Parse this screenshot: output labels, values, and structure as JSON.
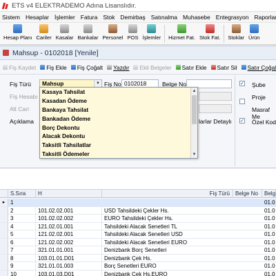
{
  "window": {
    "title": "ETS v4 ELEKTRADEMO Adına Lisanslıdır."
  },
  "menu": [
    "Sistem",
    "Hesaplar",
    "İşlemler",
    "Fatura",
    "Stok",
    "Demirbaş",
    "Satınalma",
    "Muhasebe",
    "Entegrasyon",
    "Raporlar"
  ],
  "toolbar": [
    {
      "label": "Hesap Planı",
      "icon": "account-plan-icon"
    },
    {
      "label": "Cariler",
      "icon": "customers-icon"
    },
    {
      "label": "Kasalar",
      "icon": "cash-register-icon"
    },
    {
      "label": "Bankalar",
      "icon": "bank-icon"
    },
    {
      "label": "Personel",
      "icon": "personnel-icon"
    },
    {
      "label": "POS",
      "icon": "pos-terminal-icon"
    },
    {
      "label": "İşlemler",
      "icon": "transactions-icon"
    },
    {
      "label": "Hizmet Fat.",
      "icon": "service-invoice-icon"
    },
    {
      "label": "Stok Fat.",
      "icon": "stock-invoice-icon"
    },
    {
      "label": "Stoklar",
      "icon": "stock-icon"
    },
    {
      "label": "Ürün",
      "icon": "product-icon"
    }
  ],
  "document": {
    "title": "Mahsup - 0102018  [Yenile]"
  },
  "doc_toolbar": {
    "save": "Fiş Kaydet",
    "add": "Fiş Ekle",
    "copy": "Fiş Çoğalt",
    "print": "Yazdır",
    "attach": "Ekli Belgeler",
    "row_add": "Satır Ekle",
    "row_delete": "Satır Sil",
    "row_copy": "Satır Çoğalt"
  },
  "form": {
    "fis_turu_label": "Fiş Türü",
    "fis_turu_value": "Mahsup",
    "fis_no_label": "Fiş No",
    "fis_no_value": "0102018",
    "belge_no_label": "Belge No",
    "belge_no_value": "",
    "fis_hesabi_label": "Fiş Hesabı",
    "alt_cari_label": "Alt Cari",
    "aciklama_label": "Açıklama",
    "satirlar_detayli_label": "larlar Detaylı",
    "sube_label": "Şube",
    "proje_label": "Proje",
    "masraf_label": "Masraf Me",
    "ozel_kod_label": "Özel Kod"
  },
  "dropdown_options": [
    "Kasaya Tahsilat",
    "Kasadan Ödeme",
    "Bankaya Tahsilat",
    "Bankadan Ödeme",
    "Borç Dekontu",
    "Alacak Dekontu",
    "Taksitli Tahsilatlar",
    "Taksitli Ödemeler"
  ],
  "grid": {
    "columns": [
      "S.Sıra",
      "H",
      "Fiş Türü",
      "Belge No",
      "Belg"
    ],
    "rows": [
      {
        "sira": "1",
        "hesap": "",
        "aciklama": "",
        "date": "01.0"
      },
      {
        "sira": "2",
        "hesap": "101.02.02.001",
        "aciklama": "USD Tahsildeki Çekler Hs.",
        "date": "01.0"
      },
      {
        "sira": "3",
        "hesap": "101.02.02.002",
        "aciklama": "EURO Tahsildeki Çekler Hs.",
        "date": "01.0"
      },
      {
        "sira": "4",
        "hesap": "121.02.01.001",
        "aciklama": "Tahsildeki Alacak Senetleri  TL",
        "date": "01.0"
      },
      {
        "sira": "5",
        "hesap": "121.02.02.001",
        "aciklama": "Tahsildeki Alacak Senetleri USD",
        "date": "01.0"
      },
      {
        "sira": "6",
        "hesap": "121.02.02.002",
        "aciklama": "Tahsildeki Alacak Senetleri EURO",
        "date": "01.0"
      },
      {
        "sira": "7",
        "hesap": "321.01.01.001",
        "aciklama": "Denizbank Borç Senetleri",
        "date": "01.0"
      },
      {
        "sira": "8",
        "hesap": "103.01.01.D01",
        "aciklama": "Denizbank Çek Hs.",
        "date": "01.0"
      },
      {
        "sira": "9",
        "hesap": "321.01.01.003",
        "aciklama": "Borç Senetleri EURO",
        "date": "01.0"
      },
      {
        "sira": "10",
        "hesap": "103.01.03.D01",
        "aciklama": "Denizbank Çek Hs.EURO",
        "date": "01.0"
      }
    ]
  },
  "colors": {
    "accent": "#2d6cc0",
    "dropdown_bg": "#fff9dc",
    "selected_row": "#dbe8fb",
    "logo_red": "#e02020"
  }
}
